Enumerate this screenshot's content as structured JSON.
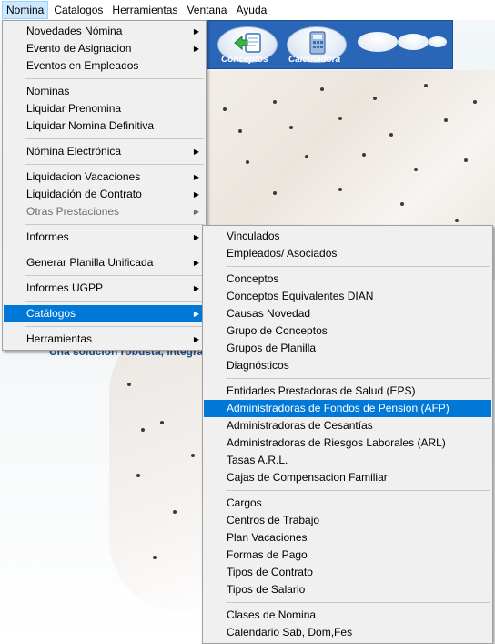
{
  "menubar": {
    "items": [
      {
        "label": "Nomina"
      },
      {
        "label": "Catalogos"
      },
      {
        "label": "Herramientas"
      },
      {
        "label": "Ventana"
      },
      {
        "label": "Ayuda"
      }
    ]
  },
  "toolbar": {
    "buttons": [
      {
        "label": "Conceptos",
        "icon": "document-arrow-icon"
      },
      {
        "label": "Calculadora",
        "icon": "calculator-icon"
      }
    ],
    "background": "#2a66b8"
  },
  "background": {
    "tagline": "Una solucion robusta, integral"
  },
  "nomina_menu": {
    "groups": [
      {
        "items": [
          {
            "label": "Novedades Nómina",
            "submenu": true
          },
          {
            "label": "Evento de Asignacion",
            "submenu": true
          },
          {
            "label": "Eventos en Empleados",
            "submenu": false
          }
        ]
      },
      {
        "items": [
          {
            "label": "Nominas",
            "submenu": false
          },
          {
            "label": "Liquidar Prenomina",
            "submenu": false
          },
          {
            "label": "Liquidar Nomina Definitiva",
            "submenu": false
          }
        ]
      },
      {
        "items": [
          {
            "label": "Nómina Electrónica",
            "submenu": true
          }
        ]
      },
      {
        "items": [
          {
            "label": "Liquidacion Vacaciones",
            "submenu": true
          },
          {
            "label": "Liquidación de Contrato",
            "submenu": true
          },
          {
            "label": "Otras Prestaciones",
            "submenu": true,
            "disabled": true
          }
        ]
      },
      {
        "items": [
          {
            "label": "Informes",
            "submenu": true
          }
        ]
      },
      {
        "items": [
          {
            "label": "Generar Planilla Unificada",
            "submenu": true
          }
        ]
      },
      {
        "items": [
          {
            "label": "Informes UGPP",
            "submenu": true
          }
        ]
      },
      {
        "items": [
          {
            "label": "Catálogos",
            "submenu": true,
            "highlighted": true
          }
        ]
      },
      {
        "items": [
          {
            "label": "Herramientas",
            "submenu": true
          }
        ]
      }
    ]
  },
  "catalogos_submenu": {
    "groups": [
      {
        "items": [
          {
            "label": "Vinculados"
          },
          {
            "label": "Empleados/ Asociados"
          }
        ]
      },
      {
        "items": [
          {
            "label": "Conceptos"
          },
          {
            "label": "Conceptos Equivalentes DIAN"
          },
          {
            "label": "Causas Novedad"
          },
          {
            "label": "Grupo de Conceptos"
          },
          {
            "label": "Grupos de Planilla"
          },
          {
            "label": "Diagnósticos"
          }
        ]
      },
      {
        "items": [
          {
            "label": "Entidades Prestadoras de Salud (EPS)"
          },
          {
            "label": "Administradoras de Fondos de Pension (AFP)",
            "highlighted": true
          },
          {
            "label": "Administradoras de Cesantías"
          },
          {
            "label": "Administradoras de Riesgos Laborales (ARL)"
          },
          {
            "label": "Tasas A.R.L."
          },
          {
            "label": "Cajas de Compensacion Familiar"
          }
        ]
      },
      {
        "items": [
          {
            "label": "Cargos"
          },
          {
            "label": "Centros de Trabajo"
          },
          {
            "label": "Plan Vacaciones"
          },
          {
            "label": "Formas de Pago"
          },
          {
            "label": "Tipos de Contrato"
          },
          {
            "label": "Tipos de Salario"
          }
        ]
      },
      {
        "items": [
          {
            "label": "Clases de Nomina"
          },
          {
            "label": "Calendario Sab, Dom,Fes"
          }
        ]
      }
    ]
  },
  "colors": {
    "highlight": "#0078d7",
    "menu_bg": "#f0f0f0",
    "menubar_active": "#cce8ff"
  }
}
